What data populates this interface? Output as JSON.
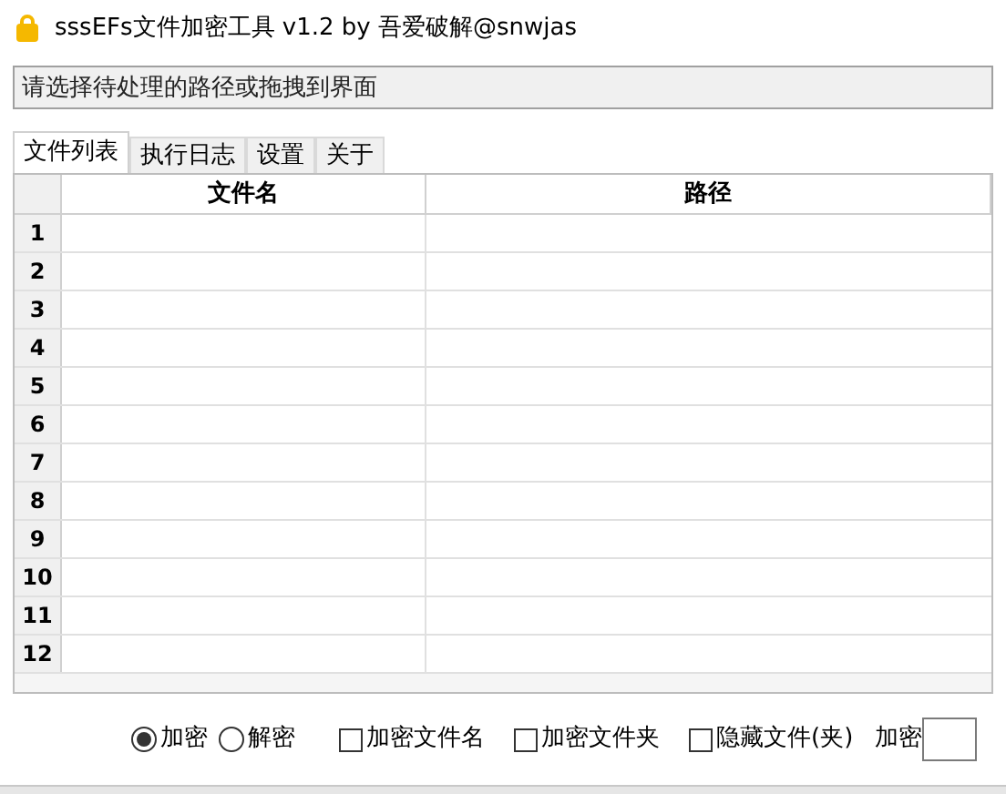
{
  "window": {
    "title": "sssEFs文件加密工具 v1.2 by 吾爱破解@snwjas"
  },
  "path_field": {
    "placeholder": "请选择待处理的路径或拖拽到界面"
  },
  "tabs": [
    {
      "label": "文件列表",
      "selected": true
    },
    {
      "label": "执行日志",
      "selected": false
    },
    {
      "label": "设置",
      "selected": false
    },
    {
      "label": "关于",
      "selected": false
    }
  ],
  "table": {
    "columns": [
      "文件名",
      "路径"
    ],
    "rows": [
      "1",
      "2",
      "3",
      "4",
      "5",
      "6",
      "7",
      "8",
      "9",
      "10",
      "11",
      "12"
    ]
  },
  "options": [
    {
      "kind": "radio",
      "label": "加密",
      "selected": true
    },
    {
      "kind": "radio",
      "label": "解密",
      "selected": false
    },
    {
      "kind": "checkbox",
      "label": "加密文件名",
      "checked": false
    },
    {
      "kind": "checkbox",
      "label": "加密文件夹",
      "checked": false
    },
    {
      "kind": "checkbox",
      "label": "隐藏文件(夹)",
      "checked": false
    }
  ],
  "password": {
    "label": "加密"
  }
}
